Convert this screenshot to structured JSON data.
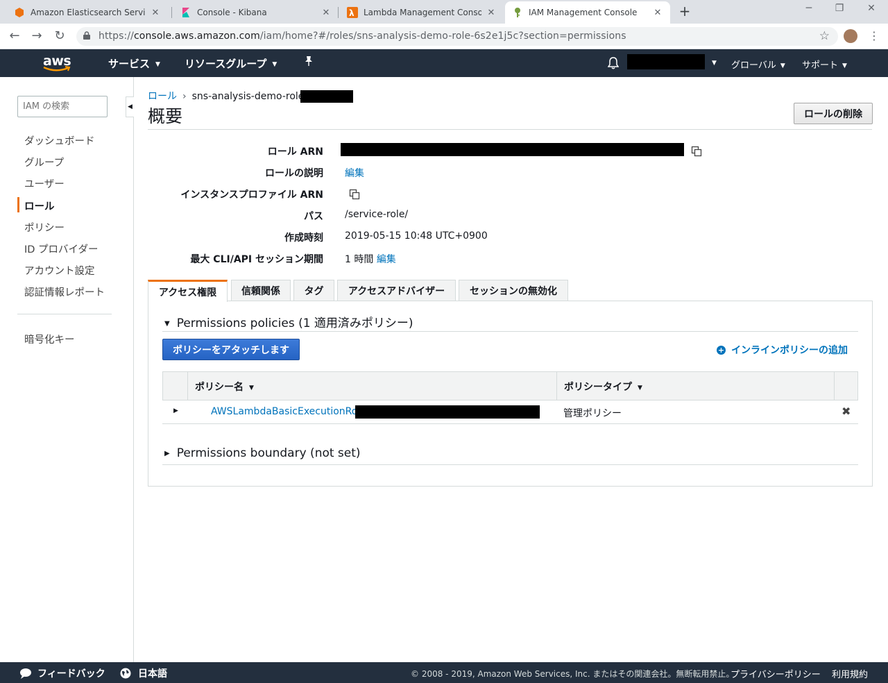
{
  "browser": {
    "tabs": [
      {
        "title": "Amazon Elasticsearch Service Ma",
        "icon": "elasticsearch-icon",
        "color": "#ec7211"
      },
      {
        "title": "Console - Kibana",
        "icon": "kibana-icon",
        "color": "#e8478b"
      },
      {
        "title": "Lambda Management Console",
        "icon": "lambda-icon",
        "color": "#ec7211"
      },
      {
        "title": "IAM Management Console",
        "icon": "iam-icon",
        "color": "#759c3e"
      }
    ],
    "url_prefix": "https://",
    "url_host": "console.aws.amazon.com",
    "url_path": "/iam/home?#/roles/sns-analysis-demo-role-6s2e1j5c?section=permissions"
  },
  "awsnav": {
    "logo": "aws",
    "services": "サービス",
    "resource_groups": "リソースグループ",
    "region": "グローバル",
    "support": "サポート"
  },
  "sidebar": {
    "search_placeholder": "IAM の検索",
    "items": [
      {
        "label": "ダッシュボード",
        "active": false
      },
      {
        "label": "グループ",
        "active": false
      },
      {
        "label": "ユーザー",
        "active": false
      },
      {
        "label": "ロール",
        "active": true
      },
      {
        "label": "ポリシー",
        "active": false
      },
      {
        "label": "ID プロバイダー",
        "active": false
      },
      {
        "label": "アカウント設定",
        "active": false
      },
      {
        "label": "認証情報レポート",
        "active": false
      }
    ],
    "extra": "暗号化キー"
  },
  "breadcrumb": {
    "root": "ロール",
    "current": "sns-analysis-demo-role-"
  },
  "page": {
    "title": "概要",
    "delete_button": "ロールの削除"
  },
  "summary": {
    "role_arn_label": "ロール ARN",
    "description_label": "ロールの説明",
    "description_edit": "編集",
    "instance_profile_label": "インスタンスプロファイル ARN",
    "path_label": "パス",
    "path_value": "/service-role/",
    "created_label": "作成時刻",
    "created_value": "2019-05-15 10:48 UTC+0900",
    "session_label": "最大 CLI/API セッション期間",
    "session_value": "1 時間",
    "session_edit": "編集"
  },
  "tabs": [
    "アクセス権限",
    "信頼関係",
    "タグ",
    "アクセスアドバイザー",
    "セッションの無効化"
  ],
  "permissions": {
    "policies_title": "Permissions policies (1 適用済みポリシー)",
    "attach_button": "ポリシーをアタッチします",
    "inline_add": "インラインポリシーの追加",
    "columns": [
      "ポリシー名",
      "ポリシータイプ"
    ],
    "rows": [
      {
        "name": "AWSLambdaBasicExecutionRole-",
        "type": "管理ポリシー"
      }
    ],
    "boundary_title": "Permissions boundary (not set)"
  },
  "footer": {
    "feedback": "フィードバック",
    "language": "日本語",
    "copyright": "© 2008 - 2019, Amazon Web Services, Inc. またはその関連会社。無断転用禁止。",
    "privacy": "プライバシーポリシー",
    "terms": "利用規約"
  },
  "colors": {
    "aws_nav": "#232f3e",
    "accent": "#ec7211",
    "link": "#0073bb",
    "primary_button": "#2e6fd1"
  }
}
